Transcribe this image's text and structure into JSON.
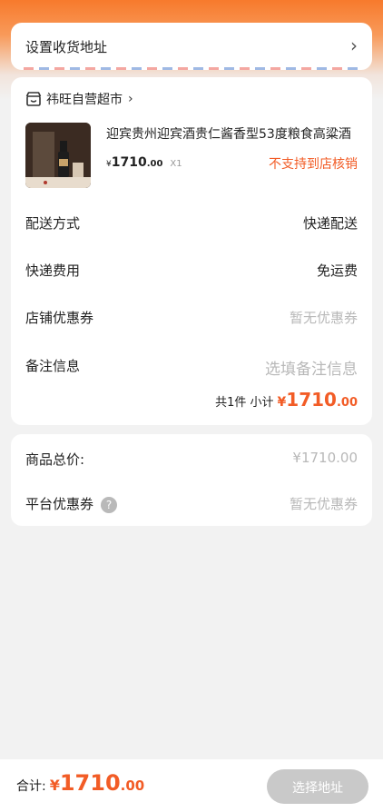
{
  "address": {
    "label": "设置收货地址",
    "chevron": "›"
  },
  "store": {
    "name": "祎旺自营超市",
    "chevron": "›",
    "icon": "shop-icon"
  },
  "product": {
    "title": "迎宾贵州迎宾酒贵仁酱香型53度粮食高粱酒",
    "price_symbol": "¥",
    "price_int": "1710",
    "price_dec": ".00",
    "qty": "X1",
    "notice": "不支持到店核销"
  },
  "order_rows": [
    {
      "label": "配送方式",
      "value": "快递配送"
    },
    {
      "label": "快递费用",
      "value": "免运费"
    },
    {
      "label": "店铺优惠券",
      "value": "暂无优惠券"
    },
    {
      "label": "备注信息",
      "value": "选填备注信息"
    }
  ],
  "subtotal": {
    "label": "共1件 小计",
    "symbol": "¥",
    "int": "1710",
    "dec": ".00"
  },
  "summary": {
    "total_label": "商品总价:",
    "total_value": "¥1710.00",
    "platform_label": "平台优惠券",
    "platform_value": "暂无优惠券",
    "help_icon": "?"
  },
  "bottom": {
    "total_label": "合计:",
    "symbol": "¥",
    "int": "1710",
    "dec": ".00",
    "button": "选择地址"
  },
  "colors": {
    "accent": "#f25c26",
    "disabled_button": "#c9c9c9"
  }
}
